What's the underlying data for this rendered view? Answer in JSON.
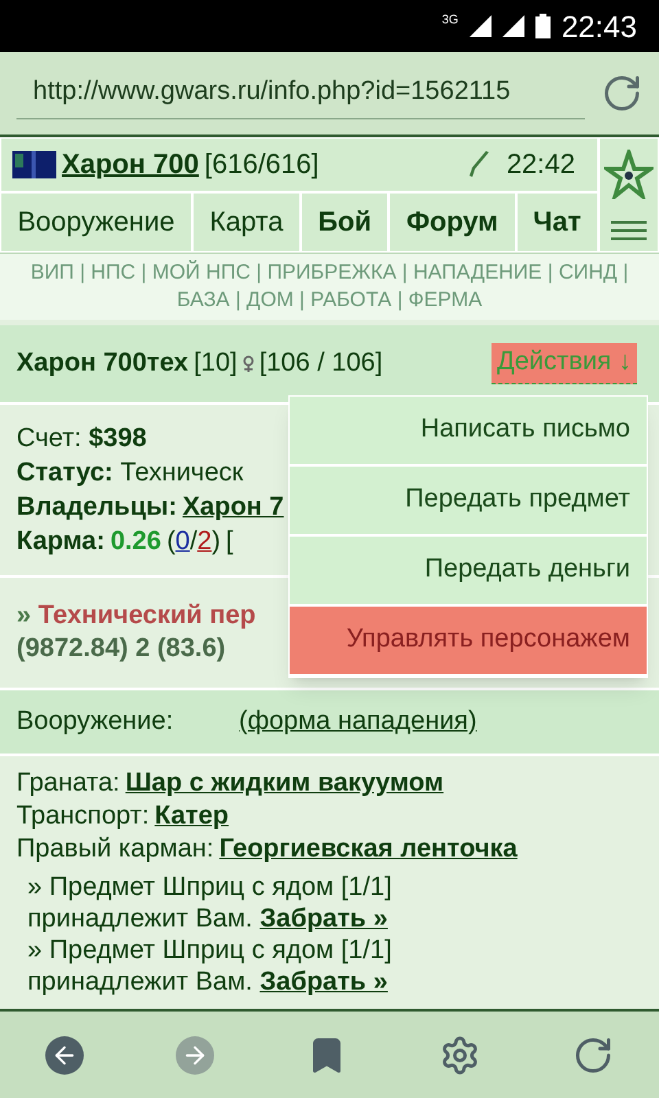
{
  "status_bar": {
    "network": "3G",
    "time": "22:43"
  },
  "url_bar": {
    "value": "http://www.gwars.ru/info.php?id=1562115"
  },
  "header": {
    "player": "Харон 700",
    "hp": "[616/616]",
    "time": "22:42"
  },
  "nav_tabs": [
    {
      "label": "Вооружение",
      "bold": false
    },
    {
      "label": "Карта",
      "bold": false
    },
    {
      "label": "Бой",
      "bold": true
    },
    {
      "label": "Форум",
      "bold": true
    },
    {
      "label": "Чат",
      "bold": true
    }
  ],
  "quick_link_separator": "|",
  "quick_links": [
    "ВИП",
    "НПС",
    "МОЙ НПС",
    "ПРИБРЕЖКА",
    "НАПАДЕНИЕ",
    "СИНД",
    "БАЗА",
    "ДОМ",
    "РАБОТА",
    "ФЕРМА"
  ],
  "character": {
    "name": "Харон 700тех",
    "level": "[10]",
    "hp": "[106 / 106]",
    "actions": "Действия",
    "actions_arrow": "↓",
    "actions_highlighted": true
  },
  "info": {
    "account_label": "Счет:",
    "account": "$398",
    "status_label": "Статус:",
    "status": "Техническ",
    "owners_label": "Владельцы:",
    "owner": "Харон 7",
    "karma_label": "Карма:",
    "karma": "0.26",
    "karma_open": "(",
    "karma_plus": "0",
    "karma_slash": "/",
    "karma_minus": "2",
    "karma_close": ")",
    "karma_rest": "["
  },
  "role": {
    "prefix": "»",
    "title": "Технический пер",
    "stats": "(9872.84) 2 (83.6)"
  },
  "actions_menu": [
    {
      "label": "Написать письмо",
      "highlighted": false
    },
    {
      "label": "Передать предмет",
      "highlighted": false
    },
    {
      "label": "Передать деньги",
      "highlighted": false
    },
    {
      "label": "Управлять персонажем",
      "highlighted": true
    }
  ],
  "armament": {
    "label": "Вооружение:",
    "link": "(форма нападения)"
  },
  "equipment": [
    {
      "label": "Граната:",
      "item": "Шар с жидким вакуумом"
    },
    {
      "label": "Транспорт:",
      "item": "Катер"
    },
    {
      "label": "Правый карман:",
      "item": "Георгиевская ленточка"
    }
  ],
  "owned_items": [
    {
      "text": "» Предмет Шприц с ядом [1/1] принадлежит Вам.",
      "link": "Забрать »"
    },
    {
      "text": "» Предмет Шприц с ядом [1/1] принадлежит Вам.",
      "link": "Забрать »"
    }
  ]
}
